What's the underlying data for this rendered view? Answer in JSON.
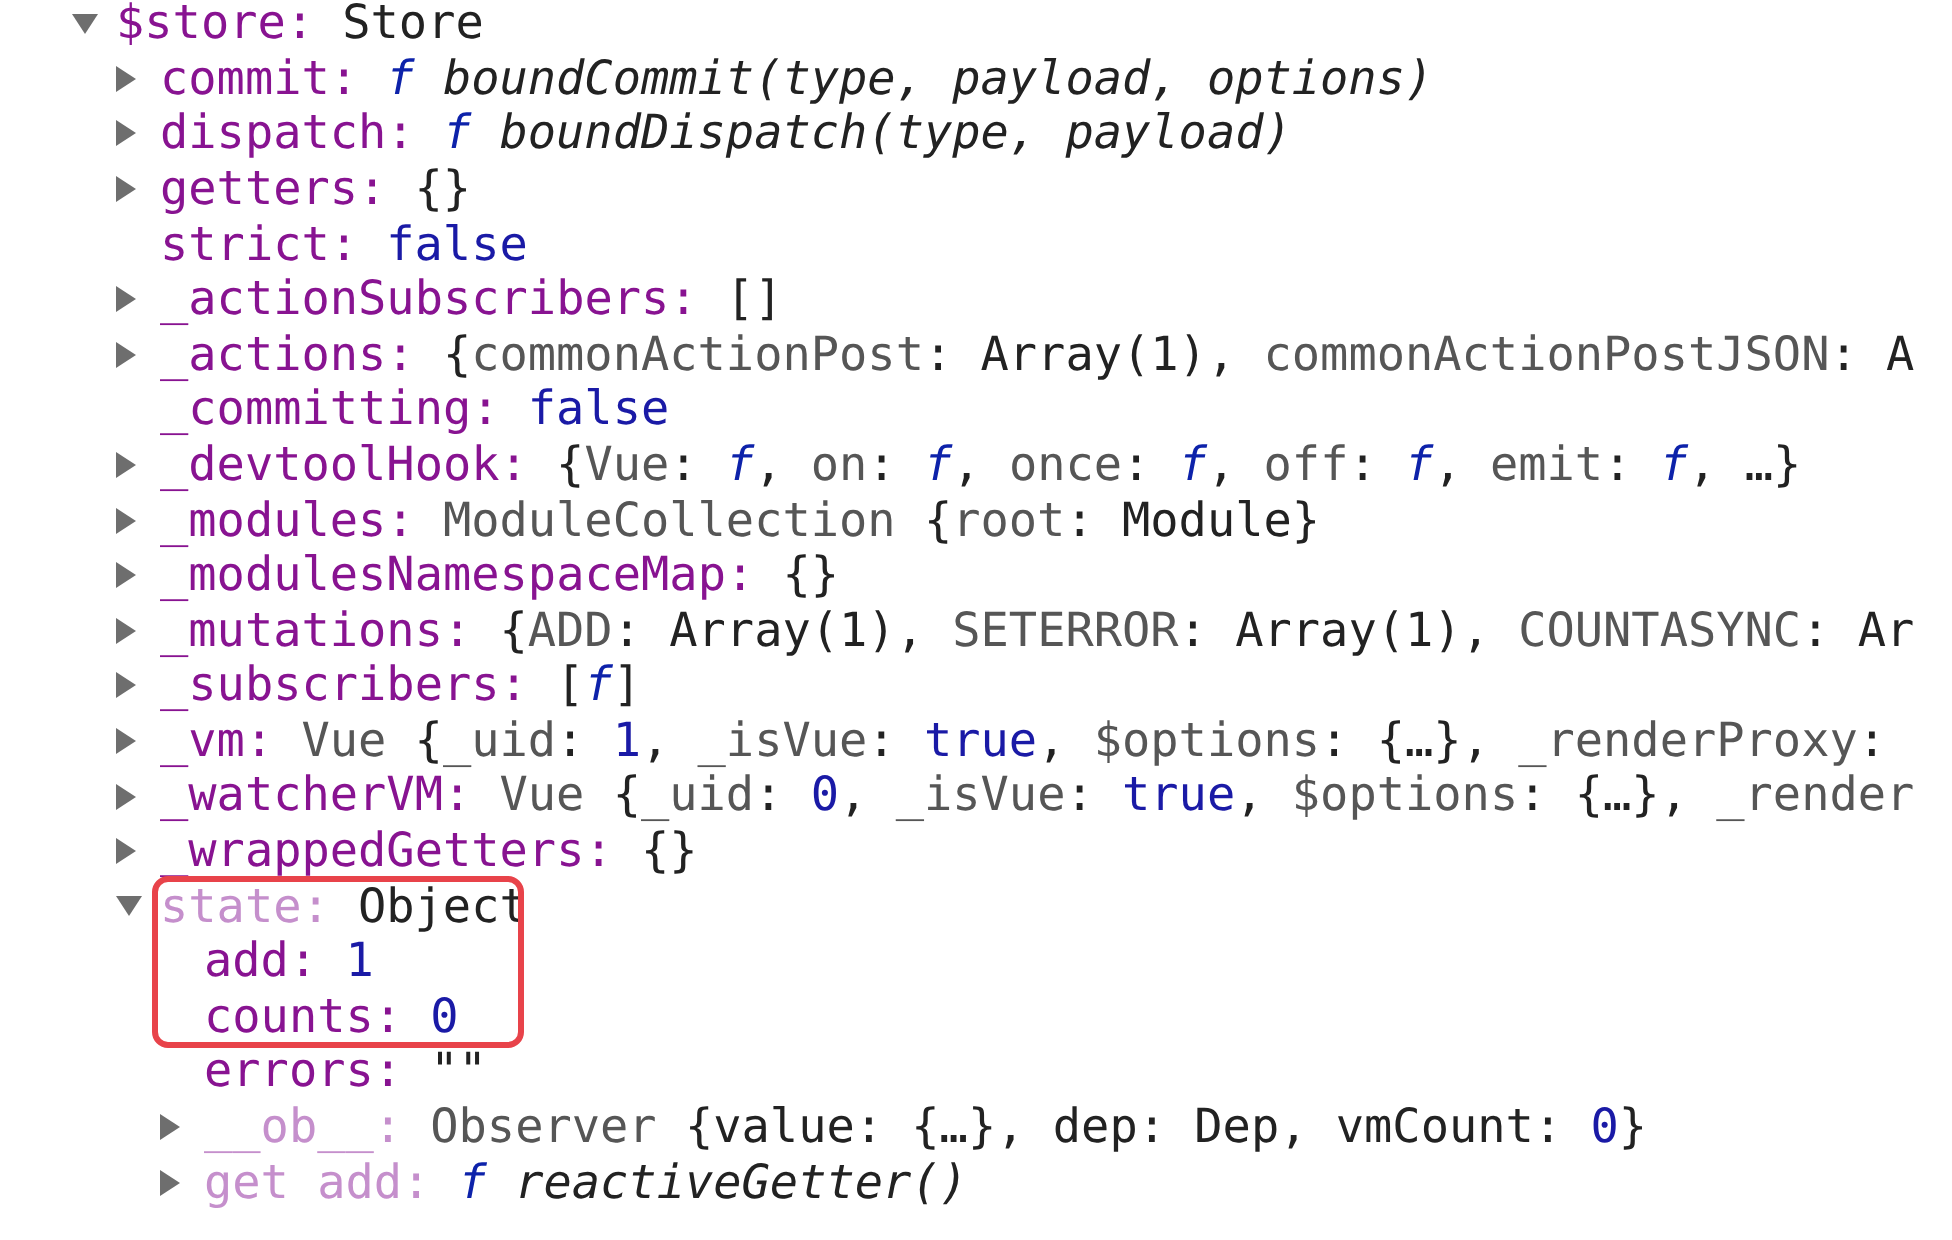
{
  "tree": {
    "key": "$store:",
    "kind": "node",
    "expanded": true,
    "faded": false,
    "value": [
      {
        "kind": "plain",
        "text": "Store"
      }
    ],
    "children": [
      {
        "key": "commit:",
        "kind": "node",
        "expanded": false,
        "faded": false,
        "value": [
          {
            "kind": "func",
            "text": "f"
          },
          {
            "kind": "italic",
            "text": " boundCommit(type, payload, options)"
          }
        ]
      },
      {
        "key": "dispatch:",
        "kind": "node",
        "expanded": false,
        "faded": false,
        "value": [
          {
            "kind": "func",
            "text": "f"
          },
          {
            "kind": "italic",
            "text": " boundDispatch(type, payload)"
          }
        ]
      },
      {
        "key": "getters:",
        "kind": "node",
        "expanded": false,
        "faded": false,
        "value": [
          {
            "kind": "plain",
            "text": "{}"
          }
        ]
      },
      {
        "key": "strict:",
        "kind": "leaf",
        "faded": false,
        "value": [
          {
            "kind": "keyword",
            "text": "false"
          }
        ]
      },
      {
        "key": "_actionSubscribers:",
        "kind": "node",
        "expanded": false,
        "faded": false,
        "value": [
          {
            "kind": "plain",
            "text": "[]"
          }
        ]
      },
      {
        "key": "_actions:",
        "kind": "node",
        "expanded": false,
        "faded": false,
        "value": [
          {
            "kind": "plain",
            "text": "{"
          },
          {
            "kind": "name",
            "text": "commonActionPost"
          },
          {
            "kind": "plain",
            "text": ": Array(1), "
          },
          {
            "kind": "name",
            "text": "commonActionPostJSON"
          },
          {
            "kind": "plain",
            "text": ": A"
          }
        ]
      },
      {
        "key": "_committing:",
        "kind": "leaf",
        "faded": false,
        "value": [
          {
            "kind": "keyword",
            "text": "false"
          }
        ]
      },
      {
        "key": "_devtoolHook:",
        "kind": "node",
        "expanded": false,
        "faded": false,
        "value": [
          {
            "kind": "plain",
            "text": "{"
          },
          {
            "kind": "name",
            "text": "Vue"
          },
          {
            "kind": "plain",
            "text": ": "
          },
          {
            "kind": "func",
            "text": "f"
          },
          {
            "kind": "plain",
            "text": ", "
          },
          {
            "kind": "name",
            "text": "on"
          },
          {
            "kind": "plain",
            "text": ": "
          },
          {
            "kind": "func",
            "text": "f"
          },
          {
            "kind": "plain",
            "text": ", "
          },
          {
            "kind": "name",
            "text": "once"
          },
          {
            "kind": "plain",
            "text": ": "
          },
          {
            "kind": "func",
            "text": "f"
          },
          {
            "kind": "plain",
            "text": ", "
          },
          {
            "kind": "name",
            "text": "off"
          },
          {
            "kind": "plain",
            "text": ": "
          },
          {
            "kind": "func",
            "text": "f"
          },
          {
            "kind": "plain",
            "text": ", "
          },
          {
            "kind": "name",
            "text": "emit"
          },
          {
            "kind": "plain",
            "text": ": "
          },
          {
            "kind": "func",
            "text": "f"
          },
          {
            "kind": "plain",
            "text": ", …}"
          }
        ]
      },
      {
        "key": "_modules:",
        "kind": "node",
        "expanded": false,
        "faded": false,
        "value": [
          {
            "kind": "name",
            "text": "ModuleCollection"
          },
          {
            "kind": "plain",
            "text": " {"
          },
          {
            "kind": "name",
            "text": "root"
          },
          {
            "kind": "plain",
            "text": ": Module}"
          }
        ]
      },
      {
        "key": "_modulesNamespaceMap:",
        "kind": "node",
        "expanded": false,
        "faded": false,
        "value": [
          {
            "kind": "plain",
            "text": "{}"
          }
        ]
      },
      {
        "key": "_mutations:",
        "kind": "node",
        "expanded": false,
        "faded": false,
        "value": [
          {
            "kind": "plain",
            "text": "{"
          },
          {
            "kind": "name",
            "text": "ADD"
          },
          {
            "kind": "plain",
            "text": ": Array(1), "
          },
          {
            "kind": "name",
            "text": "SETERROR"
          },
          {
            "kind": "plain",
            "text": ": Array(1), "
          },
          {
            "kind": "name",
            "text": "COUNTASYNC"
          },
          {
            "kind": "plain",
            "text": ": Ar"
          }
        ]
      },
      {
        "key": "_subscribers:",
        "kind": "node",
        "expanded": false,
        "faded": false,
        "value": [
          {
            "kind": "plain",
            "text": "["
          },
          {
            "kind": "func",
            "text": "f"
          },
          {
            "kind": "plain",
            "text": "]"
          }
        ]
      },
      {
        "key": "_vm:",
        "kind": "node",
        "expanded": false,
        "faded": false,
        "value": [
          {
            "kind": "name",
            "text": "Vue"
          },
          {
            "kind": "plain",
            "text": " {"
          },
          {
            "kind": "name",
            "text": "_uid"
          },
          {
            "kind": "plain",
            "text": ": "
          },
          {
            "kind": "keyword",
            "text": "1"
          },
          {
            "kind": "plain",
            "text": ", "
          },
          {
            "kind": "name",
            "text": "_isVue"
          },
          {
            "kind": "plain",
            "text": ": "
          },
          {
            "kind": "keyword",
            "text": "true"
          },
          {
            "kind": "plain",
            "text": ", "
          },
          {
            "kind": "name",
            "text": "$options"
          },
          {
            "kind": "plain",
            "text": ": {…}, "
          },
          {
            "kind": "name",
            "text": "_renderProxy"
          },
          {
            "kind": "plain",
            "text": ":"
          }
        ]
      },
      {
        "key": "_watcherVM:",
        "kind": "node",
        "expanded": false,
        "faded": false,
        "value": [
          {
            "kind": "name",
            "text": "Vue"
          },
          {
            "kind": "plain",
            "text": " {"
          },
          {
            "kind": "name",
            "text": "_uid"
          },
          {
            "kind": "plain",
            "text": ": "
          },
          {
            "kind": "keyword",
            "text": "0"
          },
          {
            "kind": "plain",
            "text": ", "
          },
          {
            "kind": "name",
            "text": "_isVue"
          },
          {
            "kind": "plain",
            "text": ": "
          },
          {
            "kind": "keyword",
            "text": "true"
          },
          {
            "kind": "plain",
            "text": ", "
          },
          {
            "kind": "name",
            "text": "$options"
          },
          {
            "kind": "plain",
            "text": ": {…}, "
          },
          {
            "kind": "name",
            "text": "_render"
          }
        ]
      },
      {
        "key": "_wrappedGetters:",
        "kind": "node",
        "expanded": false,
        "faded": false,
        "value": [
          {
            "kind": "plain",
            "text": "{}"
          }
        ]
      },
      {
        "key": "state:",
        "kind": "node",
        "expanded": true,
        "faded": true,
        "outlined": true,
        "value": [
          {
            "kind": "plain",
            "text": "Object"
          }
        ],
        "children": [
          {
            "key": "add:",
            "kind": "leaf",
            "faded": false,
            "value": [
              {
                "kind": "keyword",
                "text": "1"
              }
            ]
          },
          {
            "key": "counts:",
            "kind": "leaf",
            "faded": false,
            "value": [
              {
                "kind": "keyword",
                "text": "0"
              }
            ]
          },
          {
            "key": "errors:",
            "kind": "leaf",
            "faded": false,
            "value": [
              {
                "kind": "plain",
                "text": "\"\""
              }
            ]
          },
          {
            "key": "__ob__:",
            "kind": "node",
            "expanded": false,
            "faded": true,
            "value": [
              {
                "kind": "name",
                "text": "Observer"
              },
              {
                "kind": "plain",
                "text": " {value: {…}, dep: Dep, vmCount: "
              },
              {
                "kind": "keyword",
                "text": "0"
              },
              {
                "kind": "plain",
                "text": "}"
              }
            ]
          },
          {
            "key": "get add:",
            "kind": "node",
            "expanded": false,
            "faded": true,
            "value": [
              {
                "kind": "func",
                "text": "f"
              },
              {
                "kind": "italic",
                "text": " reactiveGetter()"
              }
            ]
          }
        ]
      }
    ]
  }
}
